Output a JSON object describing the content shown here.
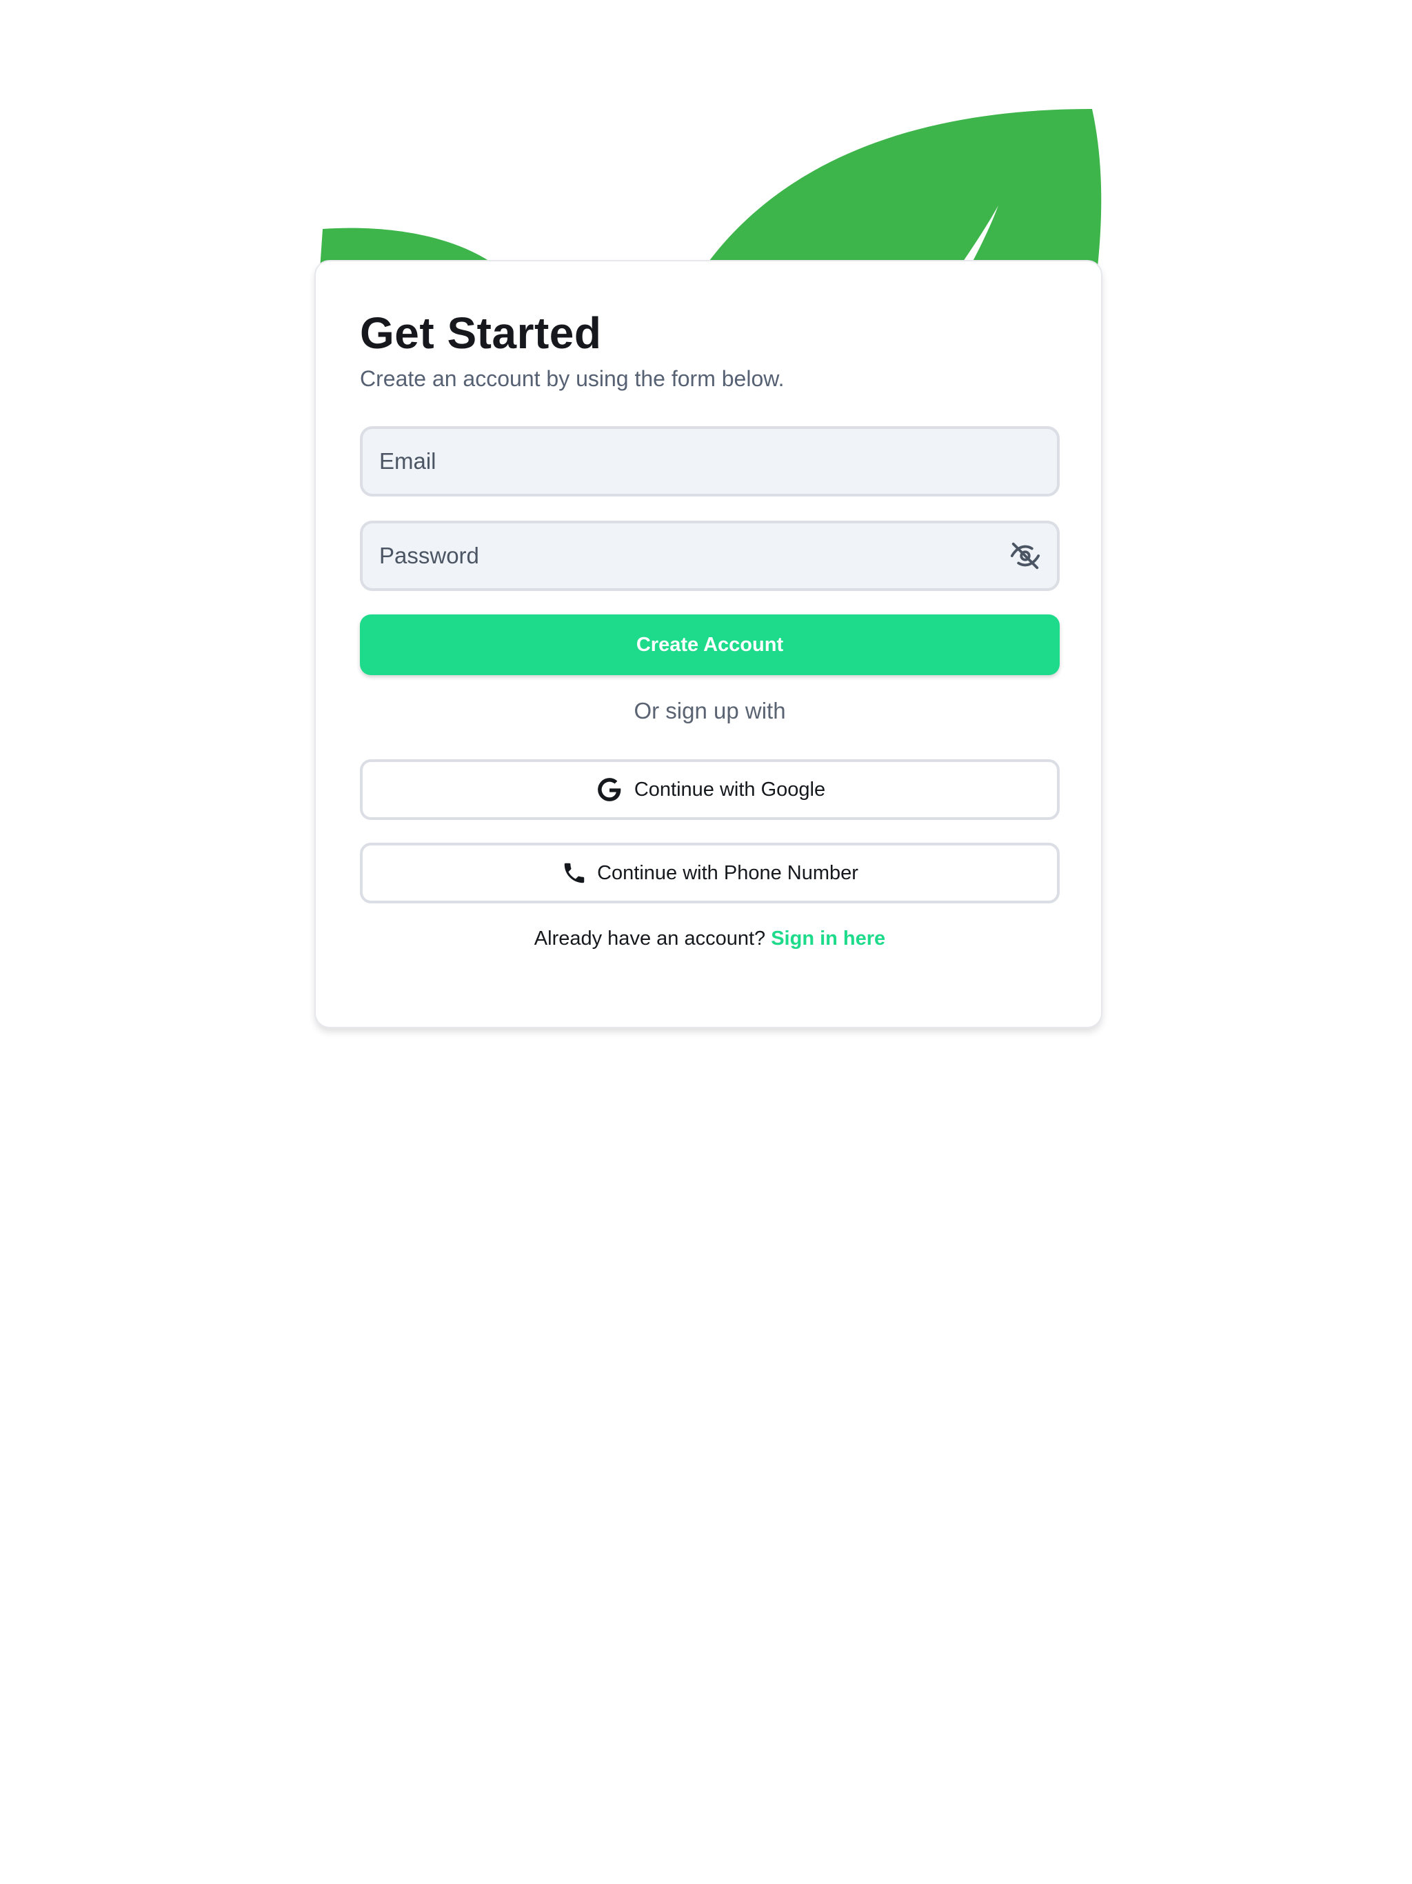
{
  "signup": {
    "title": "Get Started",
    "subtitle": "Create an account by using the form below.",
    "email": {
      "placeholder": "Email",
      "value": ""
    },
    "password": {
      "placeholder": "Password",
      "value": "",
      "toggle_icon": "eye-off-icon"
    },
    "submit_label": "Create Account",
    "divider": "Or sign up with",
    "google_label": "Continue with Google",
    "google_icon": "google-icon",
    "phone_label": "Continue with Phone Number",
    "phone_icon": "phone-icon",
    "footer_text": "Already have an account?",
    "signin_link": "Sign in here"
  },
  "colors": {
    "accent": "#1ddb8b",
    "leaf": "#3db54a",
    "input_bg": "#f0f3f8",
    "border": "#dbdee4",
    "text_muted": "#566173",
    "text_dark": "#16181d"
  },
  "decor": {
    "background_icon": "leaf-icon"
  }
}
